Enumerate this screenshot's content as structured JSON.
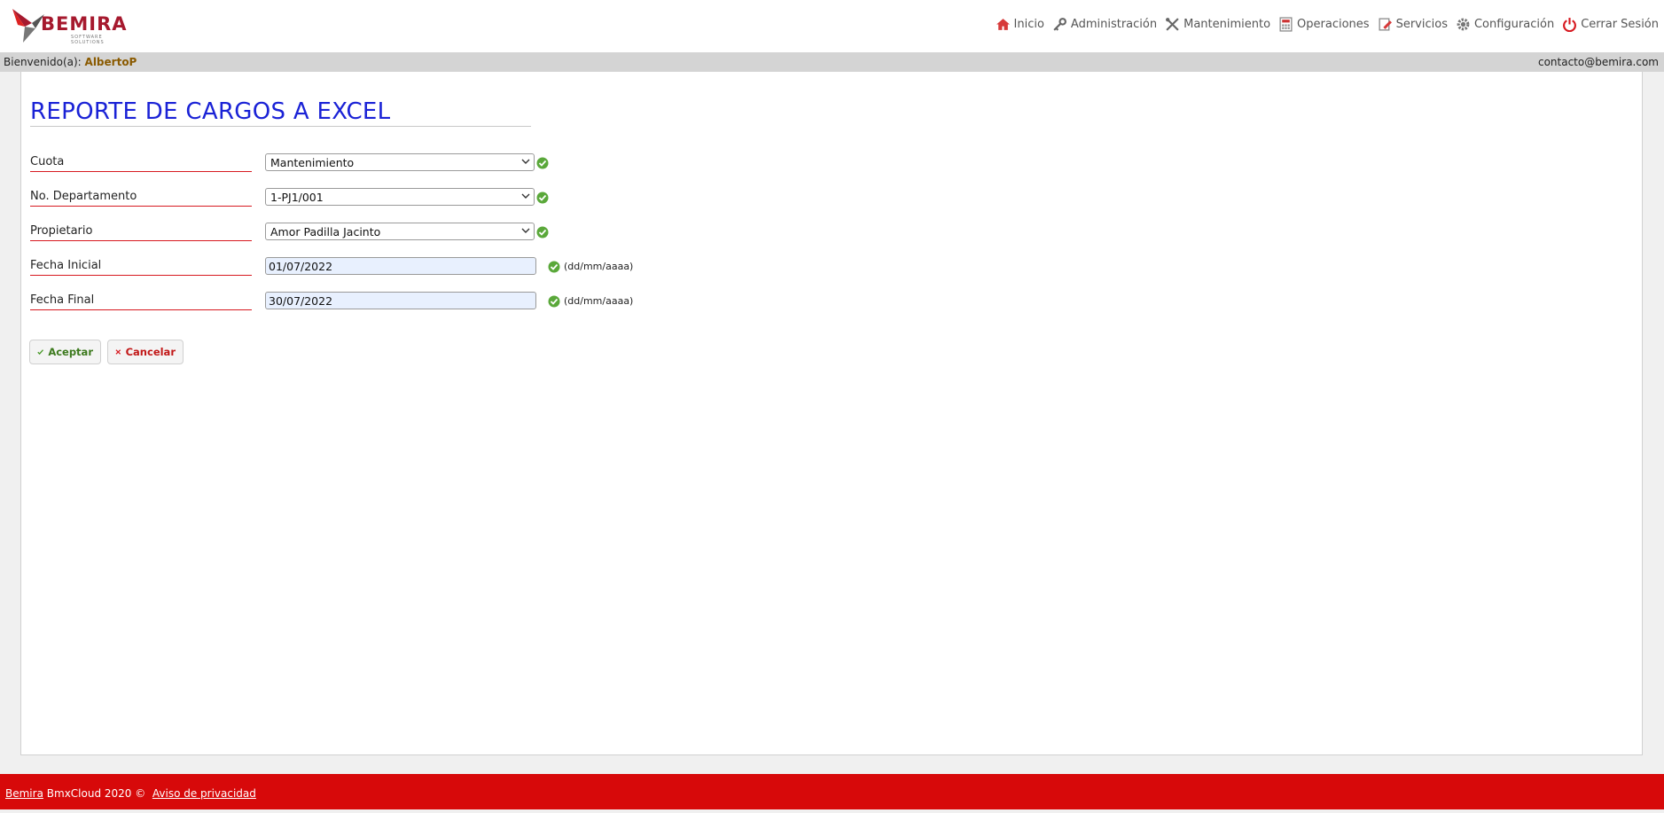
{
  "header": {
    "logo_text": "BEMIRA",
    "logo_sub": "SOFTWARE SOLUTIONS",
    "nav": [
      {
        "label": "Inicio",
        "icon": "home-icon"
      },
      {
        "label": "Administración",
        "icon": "key-icon"
      },
      {
        "label": "Mantenimiento",
        "icon": "tools-icon"
      },
      {
        "label": "Operaciones",
        "icon": "calculator-icon"
      },
      {
        "label": "Servicios",
        "icon": "edit-document-icon"
      },
      {
        "label": "Configuración",
        "icon": "gear-icon"
      },
      {
        "label": "Cerrar Sesión",
        "icon": "power-icon"
      }
    ]
  },
  "welcome": {
    "prefix": "Bienvenido(a):",
    "user": "AlbertoP",
    "email": "contacto@bemira.com"
  },
  "page": {
    "title": "REPORTE DE CARGOS A EXCEL"
  },
  "form": {
    "cuota": {
      "label": "Cuota",
      "value": "Mantenimiento"
    },
    "departamento": {
      "label": "No. Departamento",
      "value": "1-PJ1/001"
    },
    "propietario": {
      "label": "Propietario",
      "value": "Amor Padilla Jacinto"
    },
    "fecha_inicial": {
      "label": "Fecha Inicial",
      "value": "01/07/2022",
      "hint": "(dd/mm/aaaa)"
    },
    "fecha_final": {
      "label": "Fecha Final",
      "value": "30/07/2022",
      "hint": "(dd/mm/aaaa)"
    }
  },
  "buttons": {
    "accept": "Aceptar",
    "cancel": "Cancelar"
  },
  "footer": {
    "brand_link": "Bemira",
    "text": "BmxCloud 2020 ©",
    "privacy_link": "Aviso de privacidad"
  },
  "colors": {
    "accent_red": "#d7090a",
    "title_blue": "#1a22d6",
    "ok_green": "#3d7a1e"
  }
}
